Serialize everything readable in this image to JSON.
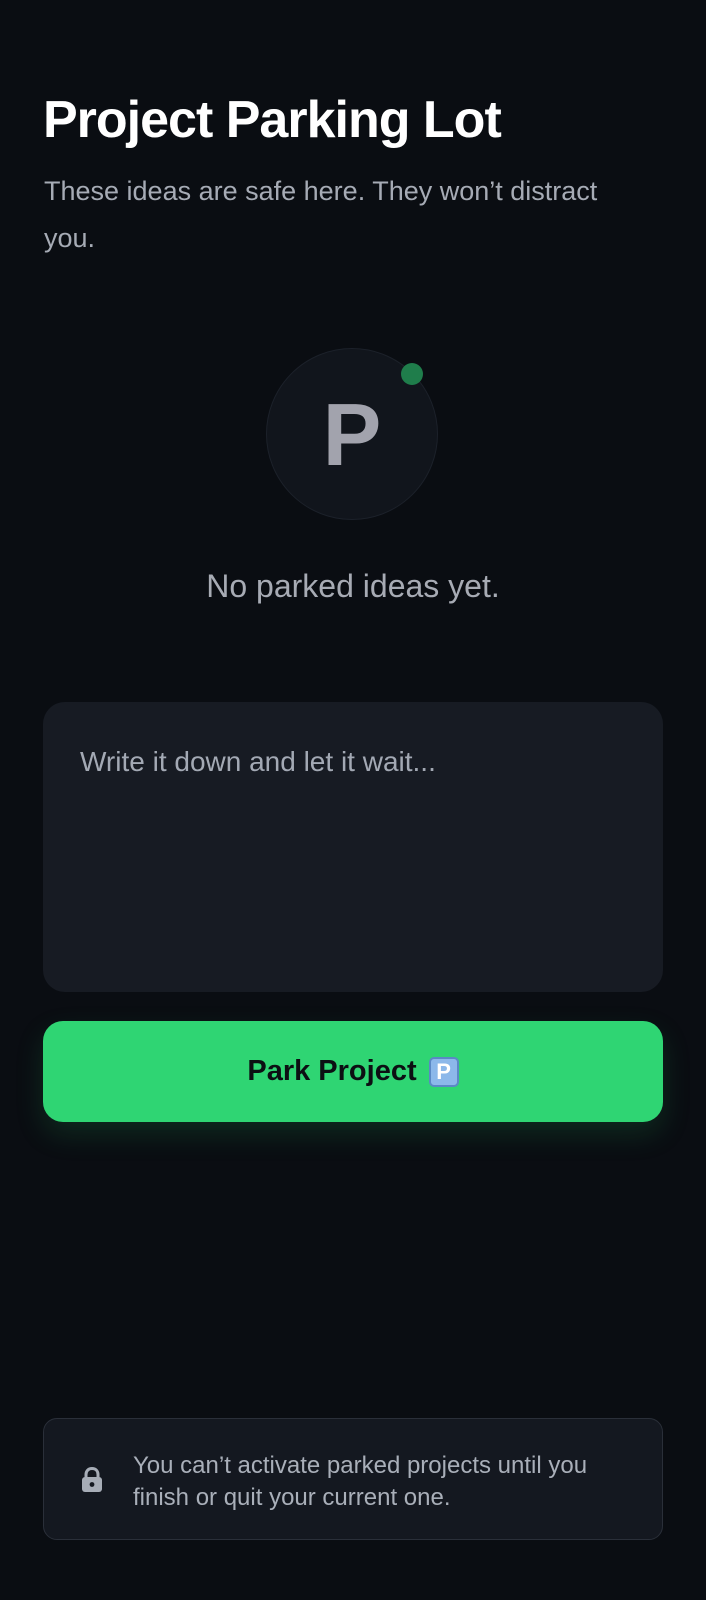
{
  "header": {
    "title": "Project Parking Lot",
    "subtitle": "These ideas are safe here. They won’t distract you."
  },
  "hero": {
    "letter": "P",
    "icon": "parking-letter-icon",
    "status": "status-dot"
  },
  "empty_state": {
    "message": "No parked ideas yet."
  },
  "idea_input": {
    "value": "",
    "placeholder": "Write it down and let it wait..."
  },
  "actions": {
    "park_label": "Park Project",
    "park_icon": "parking-sign-icon",
    "park_icon_text": "P"
  },
  "notice": {
    "icon": "lock-icon",
    "text": "You can’t activate parked projects until you finish or quit your current one."
  },
  "colors": {
    "background": "#0a0d12",
    "surface": "#171b23",
    "accent_green": "#2fd573",
    "status_green": "#1f7d4b",
    "muted_text": "#a6abb5"
  }
}
